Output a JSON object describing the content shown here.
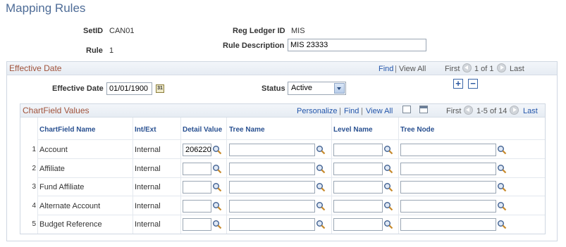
{
  "page": {
    "title": "Mapping Rules"
  },
  "header": {
    "setid_label": "SetID",
    "setid_value": "CAN01",
    "rule_label": "Rule",
    "rule_value": "1",
    "regledger_label": "Reg Ledger ID",
    "regledger_value": "MIS",
    "ruledesc_label": "Rule Description",
    "ruledesc_value": "MIS 23333"
  },
  "effdate_section": {
    "title": "Effective Date",
    "find": "Find",
    "sep": "|",
    "view_all": "View All",
    "first": "First",
    "pager": "1 of 1",
    "last": "Last",
    "effdate_label": "Effective Date",
    "effdate_value": "01/01/1900",
    "status_label": "Status",
    "status_value": "Active",
    "add_label": "+",
    "remove_label": "−",
    "calendar_glyph": "31"
  },
  "chartfield_grid": {
    "title": "ChartField Values",
    "personalize": "Personalize",
    "find": "Find",
    "view_all": "View All",
    "first": "First",
    "pager": "1-5 of 14",
    "last": "Last",
    "columns": {
      "name": "ChartField Name",
      "intext": "Int/Ext",
      "detail": "Detail Value",
      "tree": "Tree Name",
      "level": "Level Name",
      "node": "Tree Node"
    },
    "rows": [
      {
        "num": "1",
        "name": "Account",
        "intext": "Internal",
        "detail": "206220"
      },
      {
        "num": "2",
        "name": "Affiliate",
        "intext": "Internal",
        "detail": ""
      },
      {
        "num": "3",
        "name": "Fund Affiliate",
        "intext": "Internal",
        "detail": ""
      },
      {
        "num": "4",
        "name": "Alternate Account",
        "intext": "Internal",
        "detail": ""
      },
      {
        "num": "5",
        "name": "Budget Reference",
        "intext": "Internal",
        "detail": ""
      }
    ]
  },
  "icons": {
    "lookup": "magnifier-icon",
    "prev": "previous-icon",
    "next": "next-icon",
    "calendar": "calendar-icon",
    "zoom": "zoom-icon",
    "download": "download-icon"
  },
  "colors": {
    "title": "#4e6c97",
    "section_title": "#a0523a",
    "link": "#2255aa",
    "column_header": "#2a5191"
  }
}
